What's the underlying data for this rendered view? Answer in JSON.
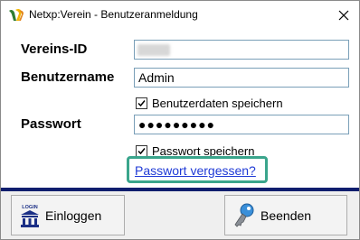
{
  "window": {
    "title": "Netxp:Verein - Benutzeranmeldung"
  },
  "form": {
    "vereins_id_label": "Vereins-ID",
    "vereins_id_value": "",
    "benutzername_label": "Benutzername",
    "benutzername_value": "Admin",
    "save_user_checkbox_label": "Benutzerdaten speichern",
    "save_user_checked": true,
    "passwort_label": "Passwort",
    "passwort_value": "●●●●●●●●●",
    "save_password_checkbox_label": "Passwort speichern",
    "save_password_checked": true,
    "forgot_link": "Passwort vergessen?"
  },
  "footer": {
    "login_button": "Einloggen",
    "login_icon_text": "LOGIN",
    "exit_button": "Beenden"
  },
  "colors": {
    "divider": "#0f1e6e",
    "link": "#1f3ad6",
    "highlight_frame": "#3aa58c",
    "field_border": "#7a9fb8"
  },
  "icons": {
    "app": "netxp-logo-icon",
    "close": "close-icon",
    "checkbox": "checkmark-icon",
    "login": "bank-login-icon",
    "exit": "key-icon"
  }
}
